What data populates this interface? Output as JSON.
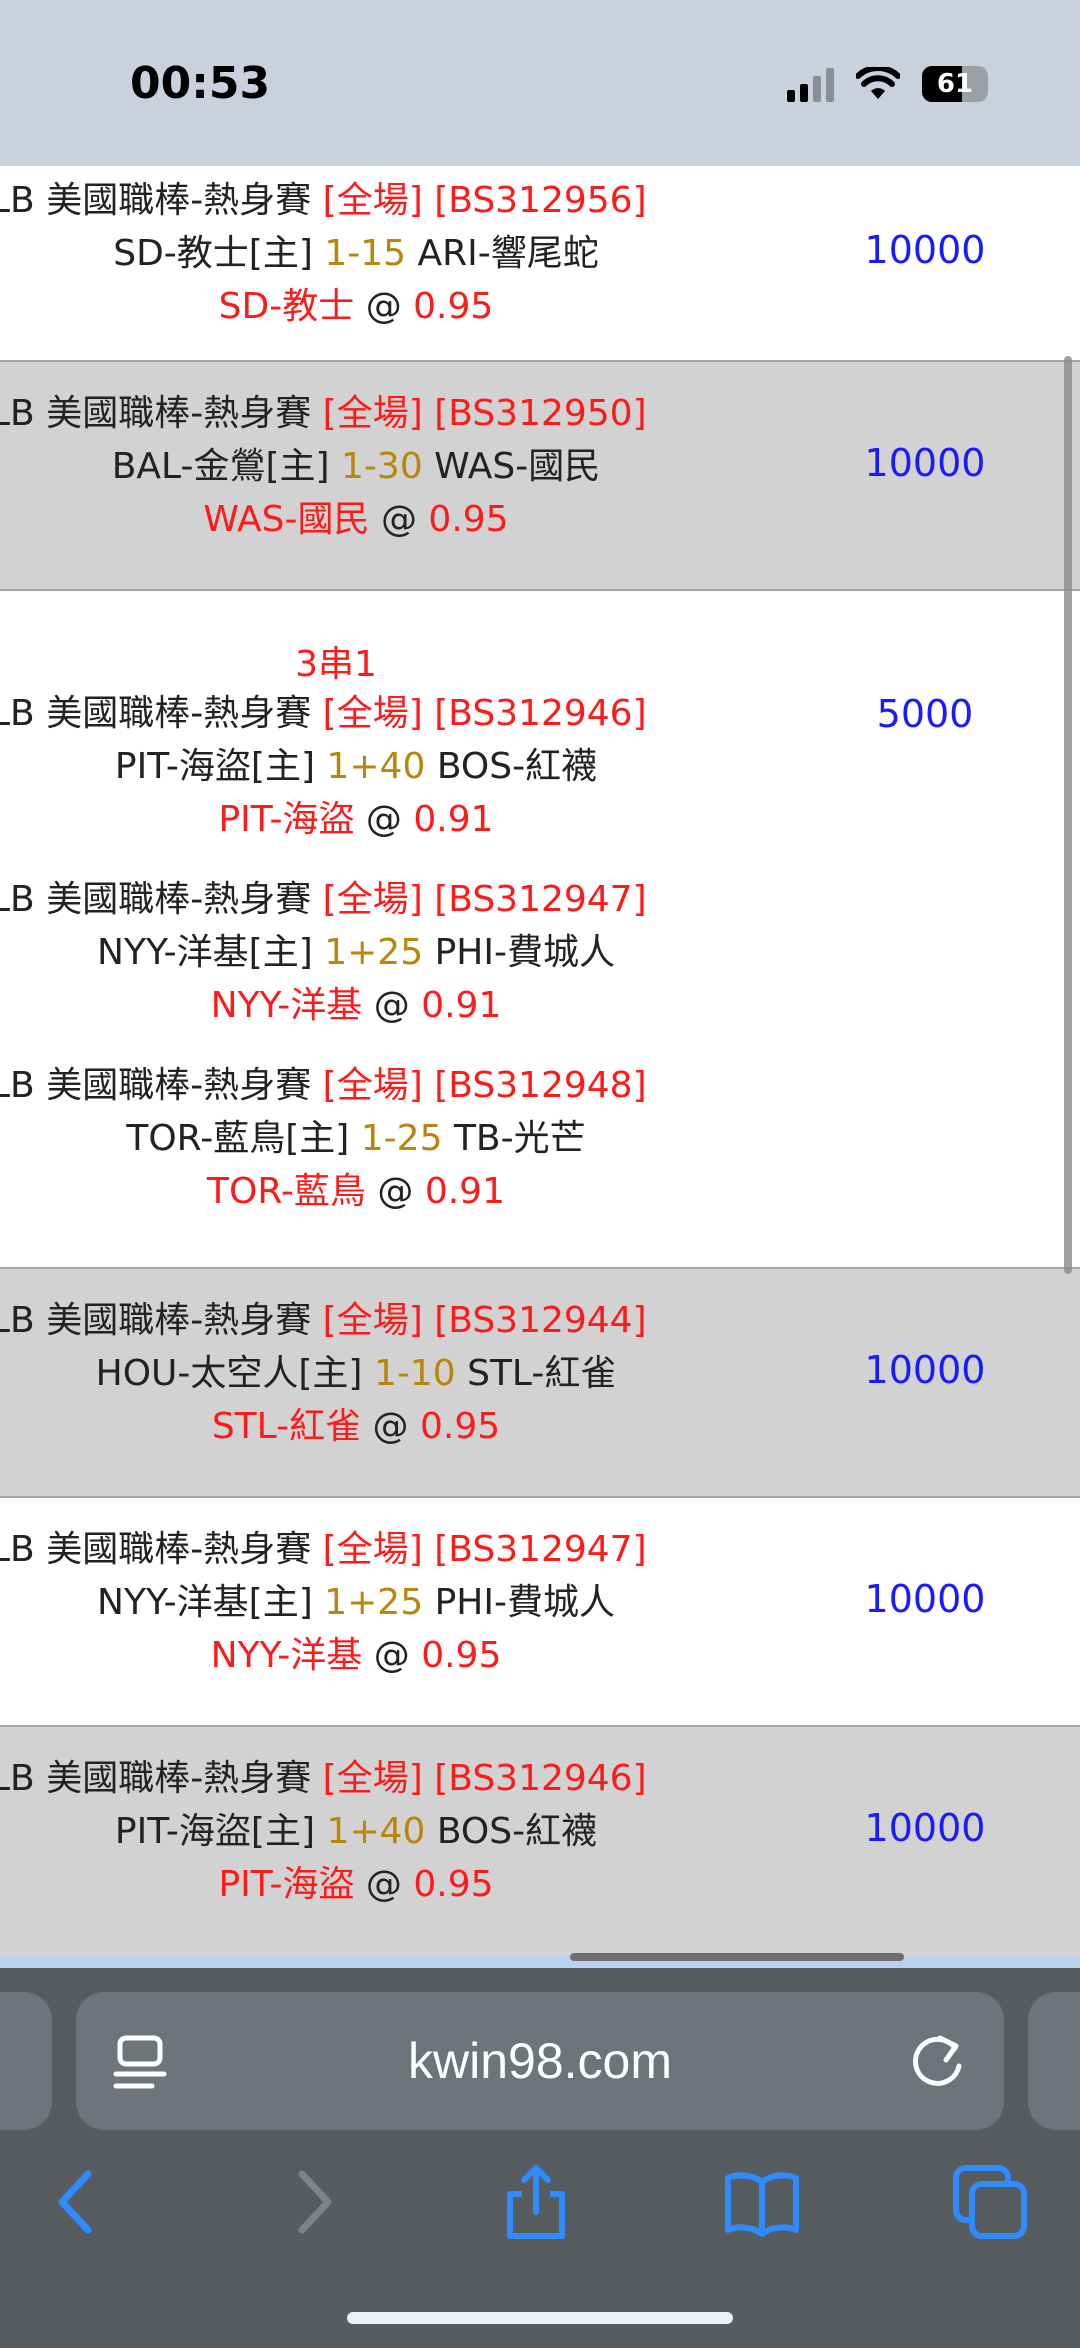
{
  "status": {
    "time": "00:53",
    "battery": "61"
  },
  "browser": {
    "url": "kwin98.com"
  },
  "bets": [
    {
      "league": "LB 美國職棒-熱身賽",
      "period": "[全場]",
      "code": "[BS312956]",
      "home": "SD-教士[主]",
      "line": "1-15",
      "away": "ARI-響尾蛇",
      "pick": "SD-教士",
      "at": "@",
      "odds": "0.95",
      "amount": "10000"
    },
    {
      "league": "LB 美國職棒-熱身賽",
      "period": "[全場]",
      "code": "[BS312950]",
      "home": "BAL-金鶯[主]",
      "line": "1-30",
      "away": "WAS-國民",
      "pick": "WAS-國民",
      "at": "@",
      "odds": "0.95",
      "amount": "10000"
    },
    {
      "parlay": "3串1",
      "amount": "5000",
      "legs": [
        {
          "league": "LB 美國職棒-熱身賽",
          "period": "[全場]",
          "code": "[BS312946]",
          "home": "PIT-海盜[主]",
          "line": "1+40",
          "away": "BOS-紅襪",
          "pick": "PIT-海盜",
          "at": "@",
          "odds": "0.91"
        },
        {
          "league": "LB 美國職棒-熱身賽",
          "period": "[全場]",
          "code": "[BS312947]",
          "home": "NYY-洋基[主]",
          "line": "1+25",
          "away": "PHI-費城人",
          "pick": "NYY-洋基",
          "at": "@",
          "odds": "0.91"
        },
        {
          "league": "LB 美國職棒-熱身賽",
          "period": "[全場]",
          "code": "[BS312948]",
          "home": "TOR-藍鳥[主]",
          "line": "1-25",
          "away": "TB-光芒",
          "pick": "TOR-藍鳥",
          "at": "@",
          "odds": "0.91"
        }
      ]
    },
    {
      "league": "LB 美國職棒-熱身賽",
      "period": "[全場]",
      "code": "[BS312944]",
      "home": "HOU-太空人[主]",
      "line": "1-10",
      "away": "STL-紅雀",
      "pick": "STL-紅雀",
      "at": "@",
      "odds": "0.95",
      "amount": "10000"
    },
    {
      "league": "LB 美國職棒-熱身賽",
      "period": "[全場]",
      "code": "[BS312947]",
      "home": "NYY-洋基[主]",
      "line": "1+25",
      "away": "PHI-費城人",
      "pick": "NYY-洋基",
      "at": "@",
      "odds": "0.95",
      "amount": "10000"
    },
    {
      "league": "LB 美國職棒-熱身賽",
      "period": "[全場]",
      "code": "[BS312946]",
      "home": "PIT-海盜[主]",
      "line": "1+40",
      "away": "BOS-紅襪",
      "pick": "PIT-海盜",
      "at": "@",
      "odds": "0.95",
      "amount": "10000"
    }
  ],
  "icons": {
    "page": "page-menu-icon",
    "reload": "reload-icon",
    "back": "back-chevron-icon",
    "forward": "forward-chevron-icon",
    "share": "share-icon",
    "bookmarks": "book-icon",
    "tabs": "tabs-icon"
  },
  "colors": {
    "accent": "#ff1a1a",
    "amount": "#1a1aff",
    "line": "#b8860b"
  }
}
